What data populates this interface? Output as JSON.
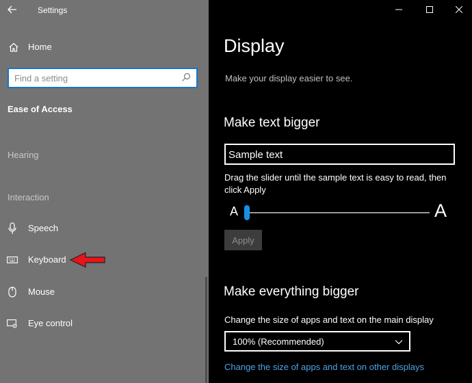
{
  "app": {
    "title": "Settings"
  },
  "sidebar": {
    "home_label": "Home",
    "search": {
      "placeholder": "Find a setting"
    },
    "section_title": "Ease of Access",
    "groups": [
      {
        "label": "Hearing"
      },
      {
        "label": "Interaction"
      }
    ],
    "items": [
      {
        "label": "Speech",
        "icon": "microphone-icon"
      },
      {
        "label": "Keyboard",
        "icon": "keyboard-icon"
      },
      {
        "label": "Mouse",
        "icon": "mouse-icon"
      },
      {
        "label": "Eye control",
        "icon": "eye-control-icon"
      }
    ]
  },
  "main": {
    "title": "Display",
    "subtitle": "Make your display easier to see.",
    "text_bigger": {
      "heading": "Make text bigger",
      "sample": "Sample text",
      "description": "Drag the slider until the sample text is easy to read, then click Apply",
      "small_a": "A",
      "large_a": "A",
      "slider_value_percent": 0,
      "apply_label": "Apply"
    },
    "everything_bigger": {
      "heading": "Make everything bigger",
      "description": "Change the size of apps and text on the main display",
      "selected": "100% (Recommended)",
      "link": "Change the size of apps and text on other displays"
    }
  },
  "colors": {
    "sidebar_bg": "#737373",
    "main_bg": "#000000",
    "accent": "#1a8ee6",
    "link": "#4da3e8",
    "annotation_arrow": "#e8141a"
  }
}
